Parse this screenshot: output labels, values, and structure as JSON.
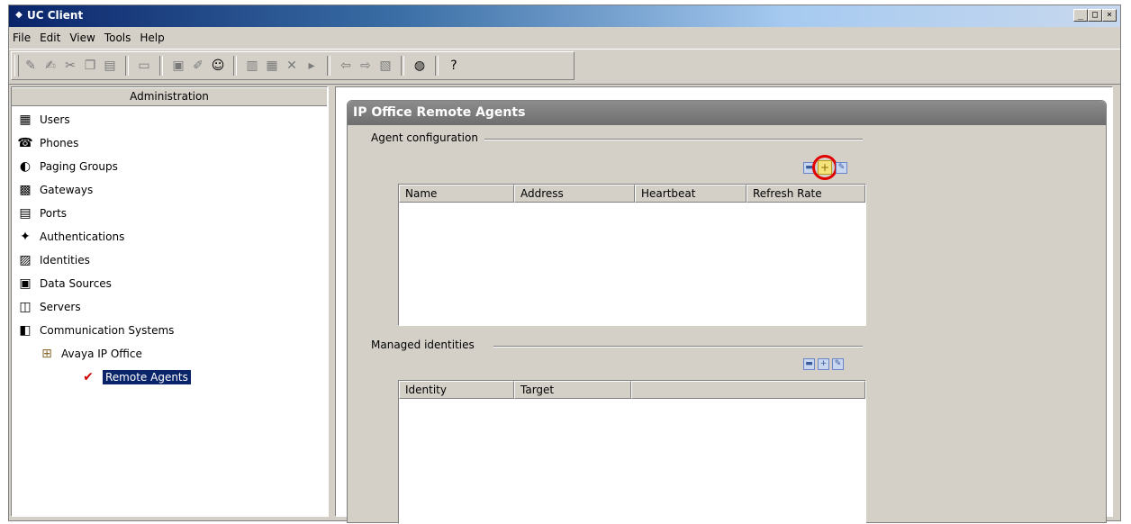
{
  "window": {
    "title": "UC Client"
  },
  "menu": [
    "File",
    "Edit",
    "View",
    "Tools",
    "Help"
  ],
  "toolbar": {
    "icons": [
      "new-icon",
      "new-sub-icon",
      "cut-icon",
      "copy-icon",
      "paste-icon",
      "open-folder-icon",
      "properties-icon",
      "edit-icon",
      "users-icon",
      "layout-left-icon",
      "layout-right-icon",
      "delete-icon",
      "play-icon",
      "back-arrow-icon",
      "forward-arrow-icon",
      "document-icon",
      "globe-icon",
      "help-icon"
    ]
  },
  "left_panel": {
    "header": "Administration",
    "items": [
      {
        "label": "Users",
        "icon": "users-icon",
        "level": 0
      },
      {
        "label": "Phones",
        "icon": "phone-icon",
        "level": 0
      },
      {
        "label": "Paging Groups",
        "icon": "paging-icon",
        "level": 0
      },
      {
        "label": "Gateways",
        "icon": "gateway-icon",
        "level": 0
      },
      {
        "label": "Ports",
        "icon": "port-icon",
        "level": 0
      },
      {
        "label": "Authentications",
        "icon": "auth-icon",
        "level": 0
      },
      {
        "label": "Identities",
        "icon": "identity-icon",
        "level": 0
      },
      {
        "label": "Data Sources",
        "icon": "datasource-icon",
        "level": 0
      },
      {
        "label": "Servers",
        "icon": "server-icon",
        "level": 0
      },
      {
        "label": "Communication Systems",
        "icon": "comm-system-icon",
        "level": 0
      },
      {
        "label": "Avaya IP Office",
        "icon": "ipoffice-icon",
        "level": 1
      },
      {
        "label": "Remote Agents",
        "icon": "checklist-icon",
        "level": 2,
        "selected": true
      }
    ]
  },
  "main": {
    "title": "IP Office Remote Agents",
    "agent_configuration": {
      "label": "Agent configuration",
      "columns": [
        "Name",
        "Address",
        "Heartbeat",
        "Refresh Rate"
      ]
    },
    "managed_identities": {
      "label": "Managed identities",
      "columns": [
        "Identity",
        "Target",
        ""
      ]
    }
  },
  "colors": {
    "highlight": "#e00000",
    "selection": "#0a246a",
    "header": "#7a7a7a"
  }
}
